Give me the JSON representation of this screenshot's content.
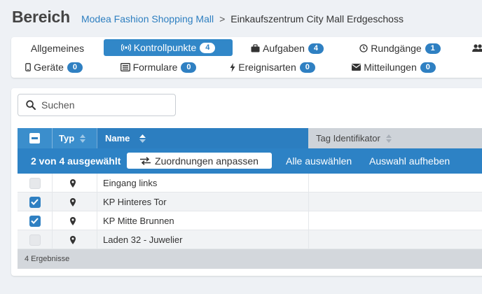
{
  "header": {
    "title": "Bereich",
    "breadcrumb": {
      "link": "Modea Fashion Shopping Mall",
      "separator": ">",
      "current": "Einkaufszentrum City Mall Erdgeschoss"
    }
  },
  "tabs": {
    "allgemeines": {
      "label": "Allgemeines"
    },
    "kontrollpunkte": {
      "label": "Kontrollpunkte",
      "badge": "4",
      "active": true
    },
    "aufgaben": {
      "label": "Aufgaben",
      "badge": "4"
    },
    "rundgaenge": {
      "label": "Rundgänge",
      "badge": "1"
    },
    "geraete": {
      "label": "Geräte",
      "badge": "0"
    },
    "formulare": {
      "label": "Formulare",
      "badge": "0"
    },
    "ereignisarten": {
      "label": "Ereignisarten",
      "badge": "0"
    },
    "mitteilungen": {
      "label": "Mitteilungen",
      "badge": "0"
    }
  },
  "search": {
    "placeholder": "Suchen",
    "value": ""
  },
  "table": {
    "columns": {
      "typ": "Typ",
      "name": "Name",
      "tag": "Tag Identifikator"
    },
    "selection_bar": {
      "count": "2 von 4 ausgewählt",
      "assign_button": "Zuordnungen anpassen",
      "select_all": "Alle auswählen",
      "deselect": "Auswahl aufheben"
    },
    "rows": [
      {
        "name": "Eingang links",
        "tag": "",
        "selected": false,
        "type_icon": "map-marker-icon"
      },
      {
        "name": "KP Hinteres Tor",
        "tag": "",
        "selected": true,
        "type_icon": "map-marker-icon"
      },
      {
        "name": "KP Mitte Brunnen",
        "tag": "",
        "selected": true,
        "type_icon": "map-marker-icon"
      },
      {
        "name": "Laden 32 - Juwelier",
        "tag": "",
        "selected": false,
        "type_icon": "map-marker-icon"
      }
    ],
    "footer": "4 Ergebnisse"
  },
  "colors": {
    "primary": "#3187c8",
    "header_active": "#2c7ec0",
    "background": "#eef1f5"
  }
}
